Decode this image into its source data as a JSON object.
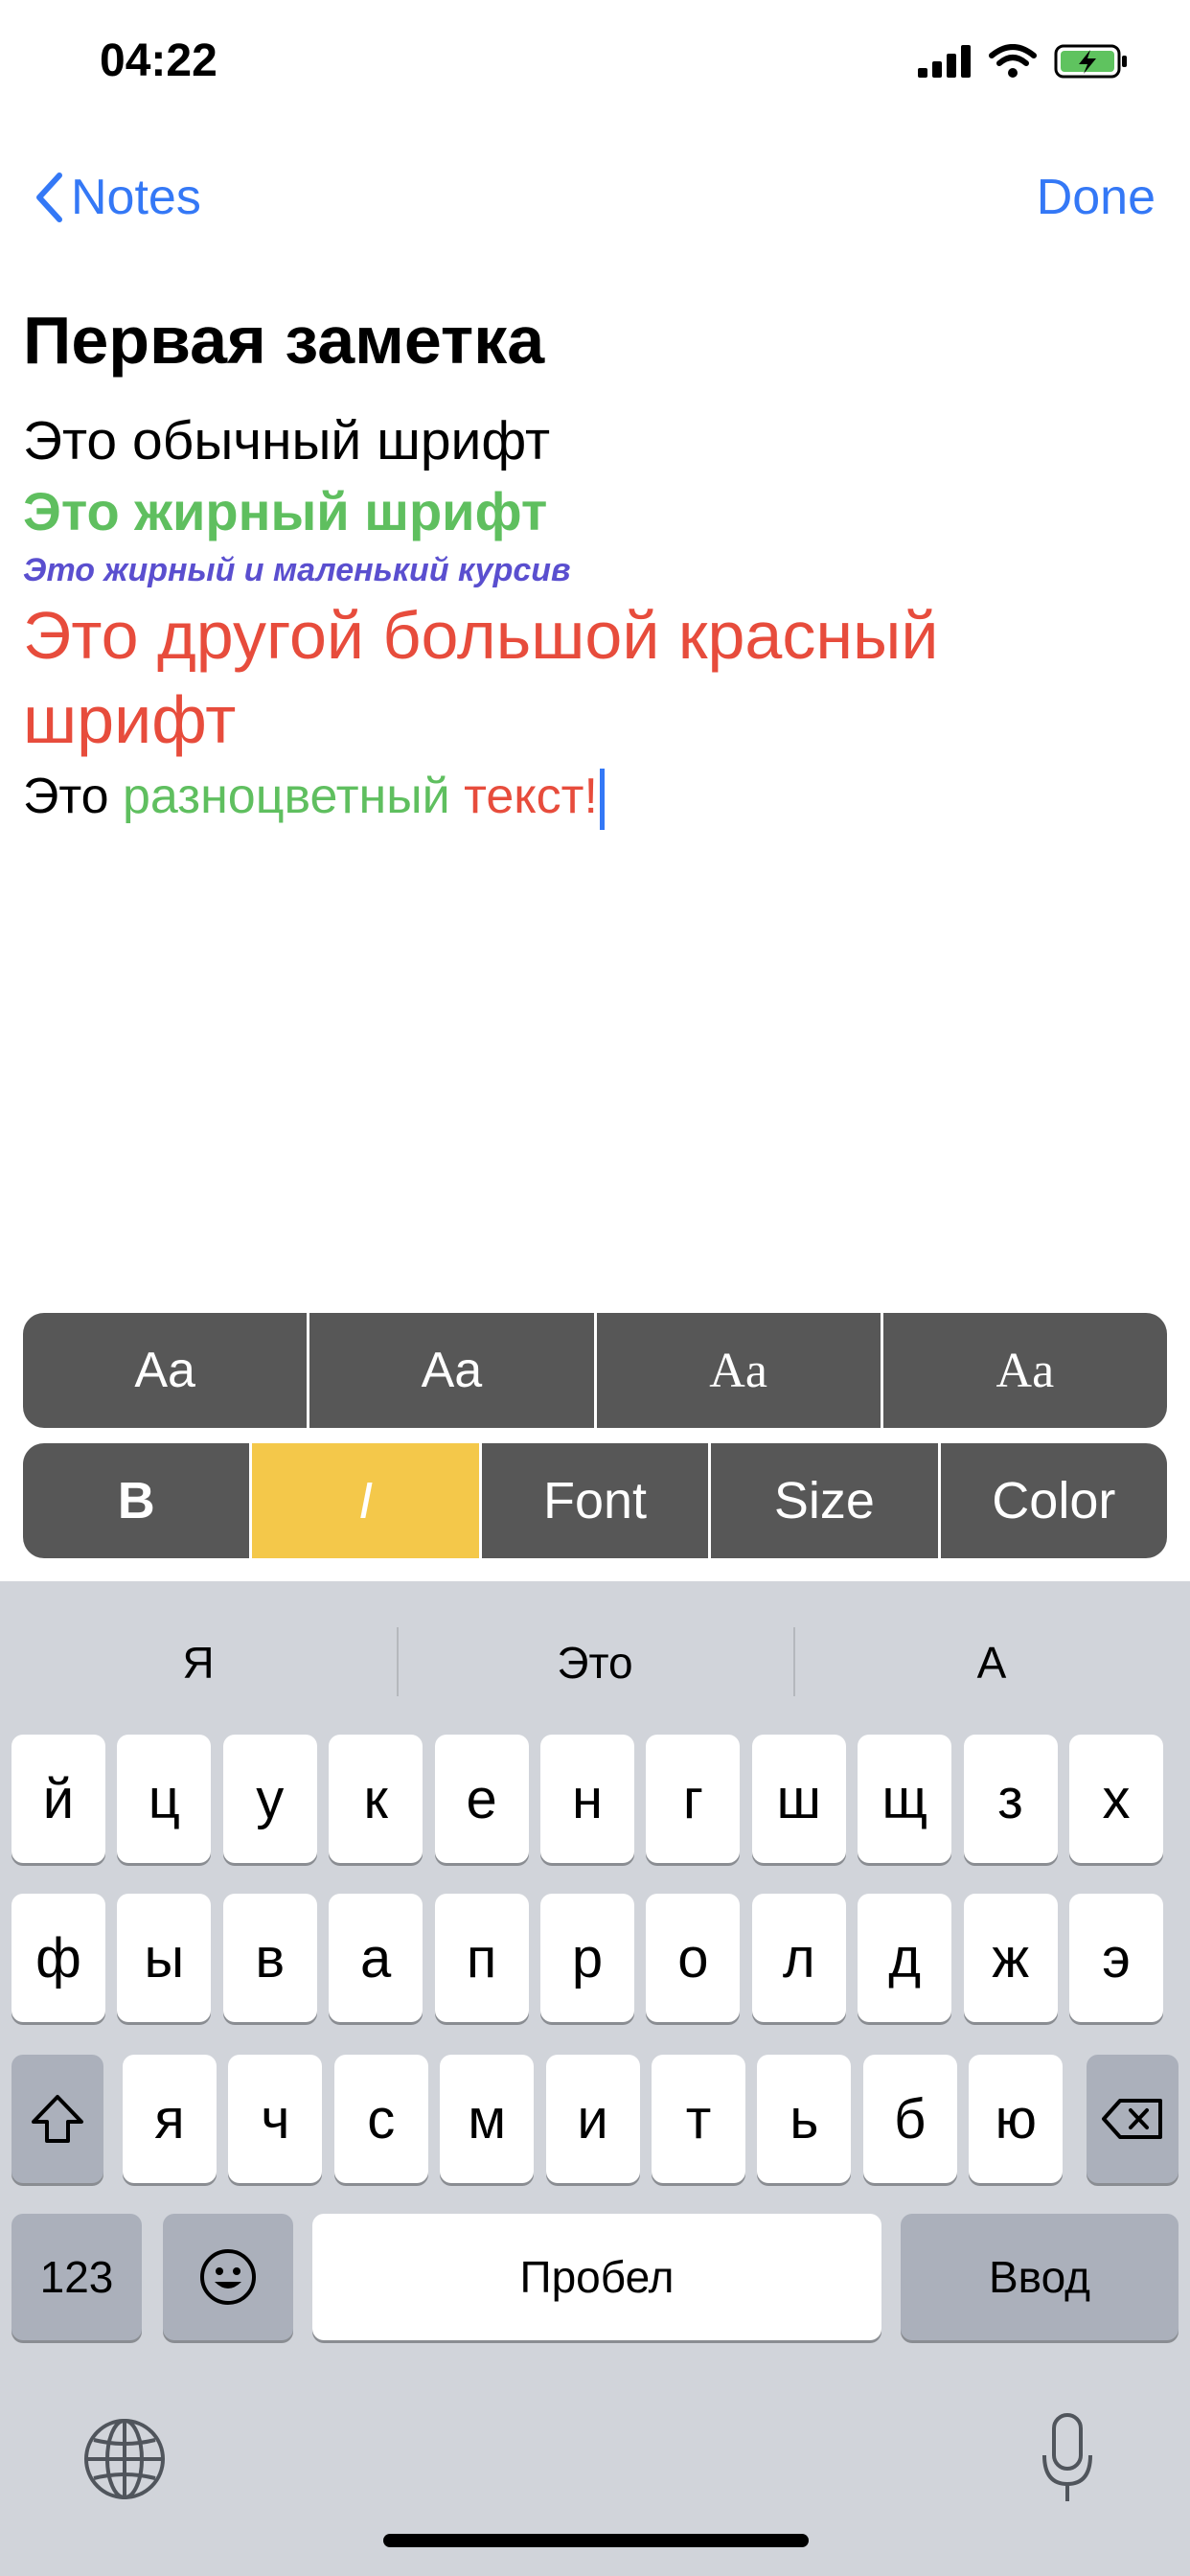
{
  "status": {
    "time": "04:22"
  },
  "nav": {
    "back_label": "Notes",
    "done_label": "Done"
  },
  "note": {
    "title": "Первая заметка",
    "line1": "Это обычный шрифт",
    "line2": "Это жирный шрифт",
    "line3": "Это жирный и маленький курсив",
    "line4": "Это другой большой красный шрифт",
    "line5": {
      "a": "Это ",
      "b": "разноцветный",
      "c": " ",
      "d": "текст",
      "e": "!"
    }
  },
  "style_bar": {
    "items": [
      "Aa",
      "Aa",
      "Aa",
      "Aa"
    ]
  },
  "format_bar": {
    "bold": "B",
    "italic": "I",
    "font": "Font",
    "size": "Size",
    "color": "Color"
  },
  "colors": {
    "accent": "#3478f6",
    "green": "#5fbf5f",
    "purple": "#5a4fcf",
    "red": "#e74c3c",
    "active_format": "#f4c84a"
  },
  "keyboard": {
    "suggestions": [
      "Я",
      "Это",
      "А"
    ],
    "row1": [
      "й",
      "ц",
      "у",
      "к",
      "е",
      "н",
      "г",
      "ш",
      "щ",
      "з",
      "х"
    ],
    "row2": [
      "ф",
      "ы",
      "в",
      "а",
      "п",
      "р",
      "о",
      "л",
      "д",
      "ж",
      "э"
    ],
    "row3": [
      "я",
      "ч",
      "с",
      "м",
      "и",
      "т",
      "ь",
      "б",
      "ю"
    ],
    "numbers_label": "123",
    "space_label": "Пробел",
    "return_label": "Ввод"
  }
}
